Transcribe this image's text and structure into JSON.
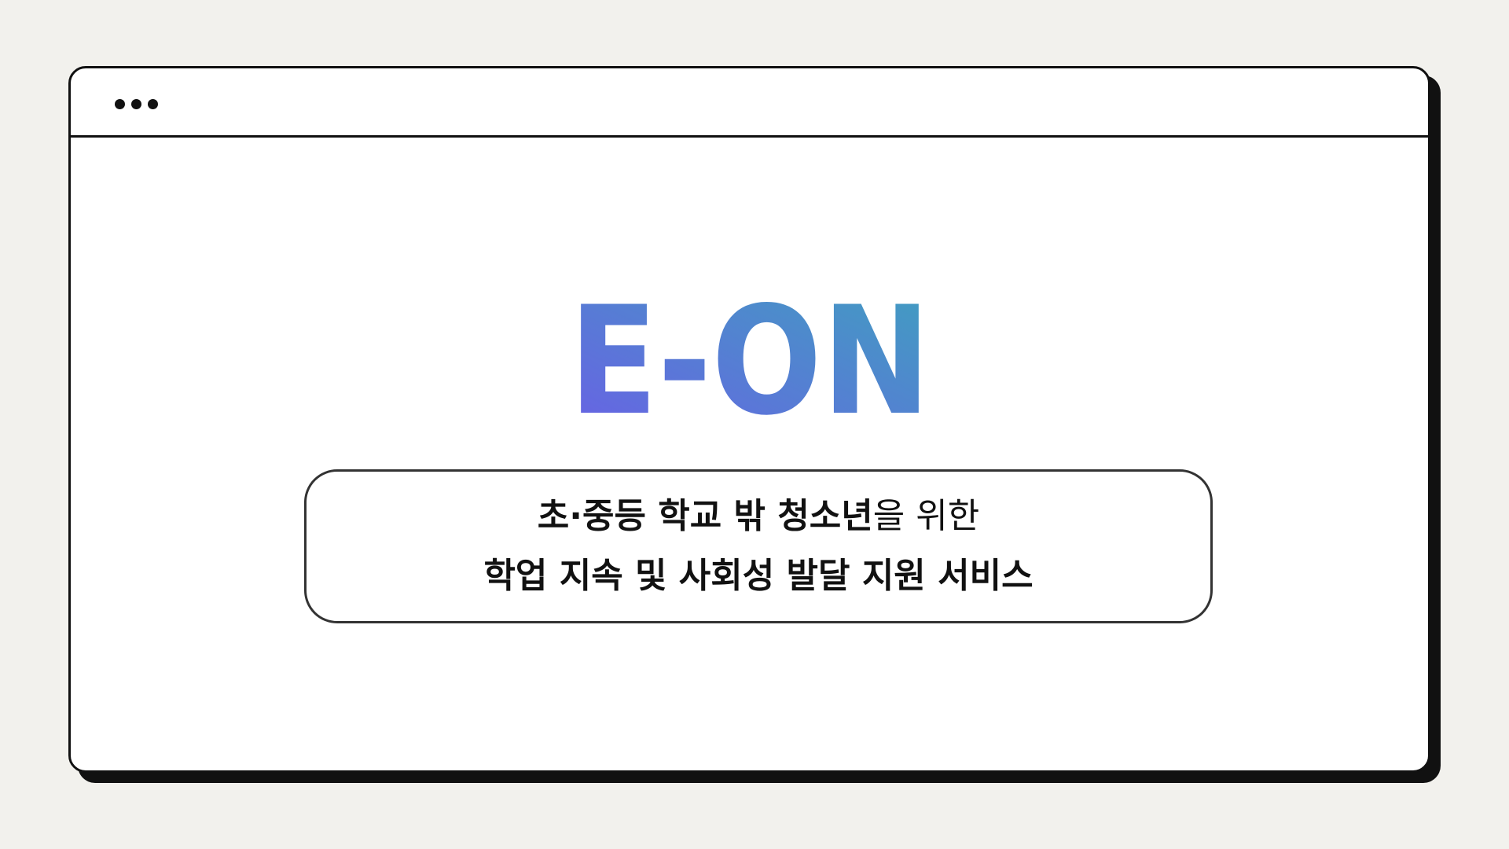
{
  "window": {
    "menu_icon": "more-dots-icon"
  },
  "logo": {
    "text": "E-ON",
    "gradient_start": "#6a5fe6",
    "gradient_end": "#3fa0bf"
  },
  "tagline": {
    "line1_bold": "초·중등 학교 밖 청소년",
    "line1_regular": "을 위한",
    "line2": "학업 지속 및 사회성 발달 지원 서비스"
  },
  "colors": {
    "background": "#f2f1ed",
    "frame": "#111111"
  }
}
